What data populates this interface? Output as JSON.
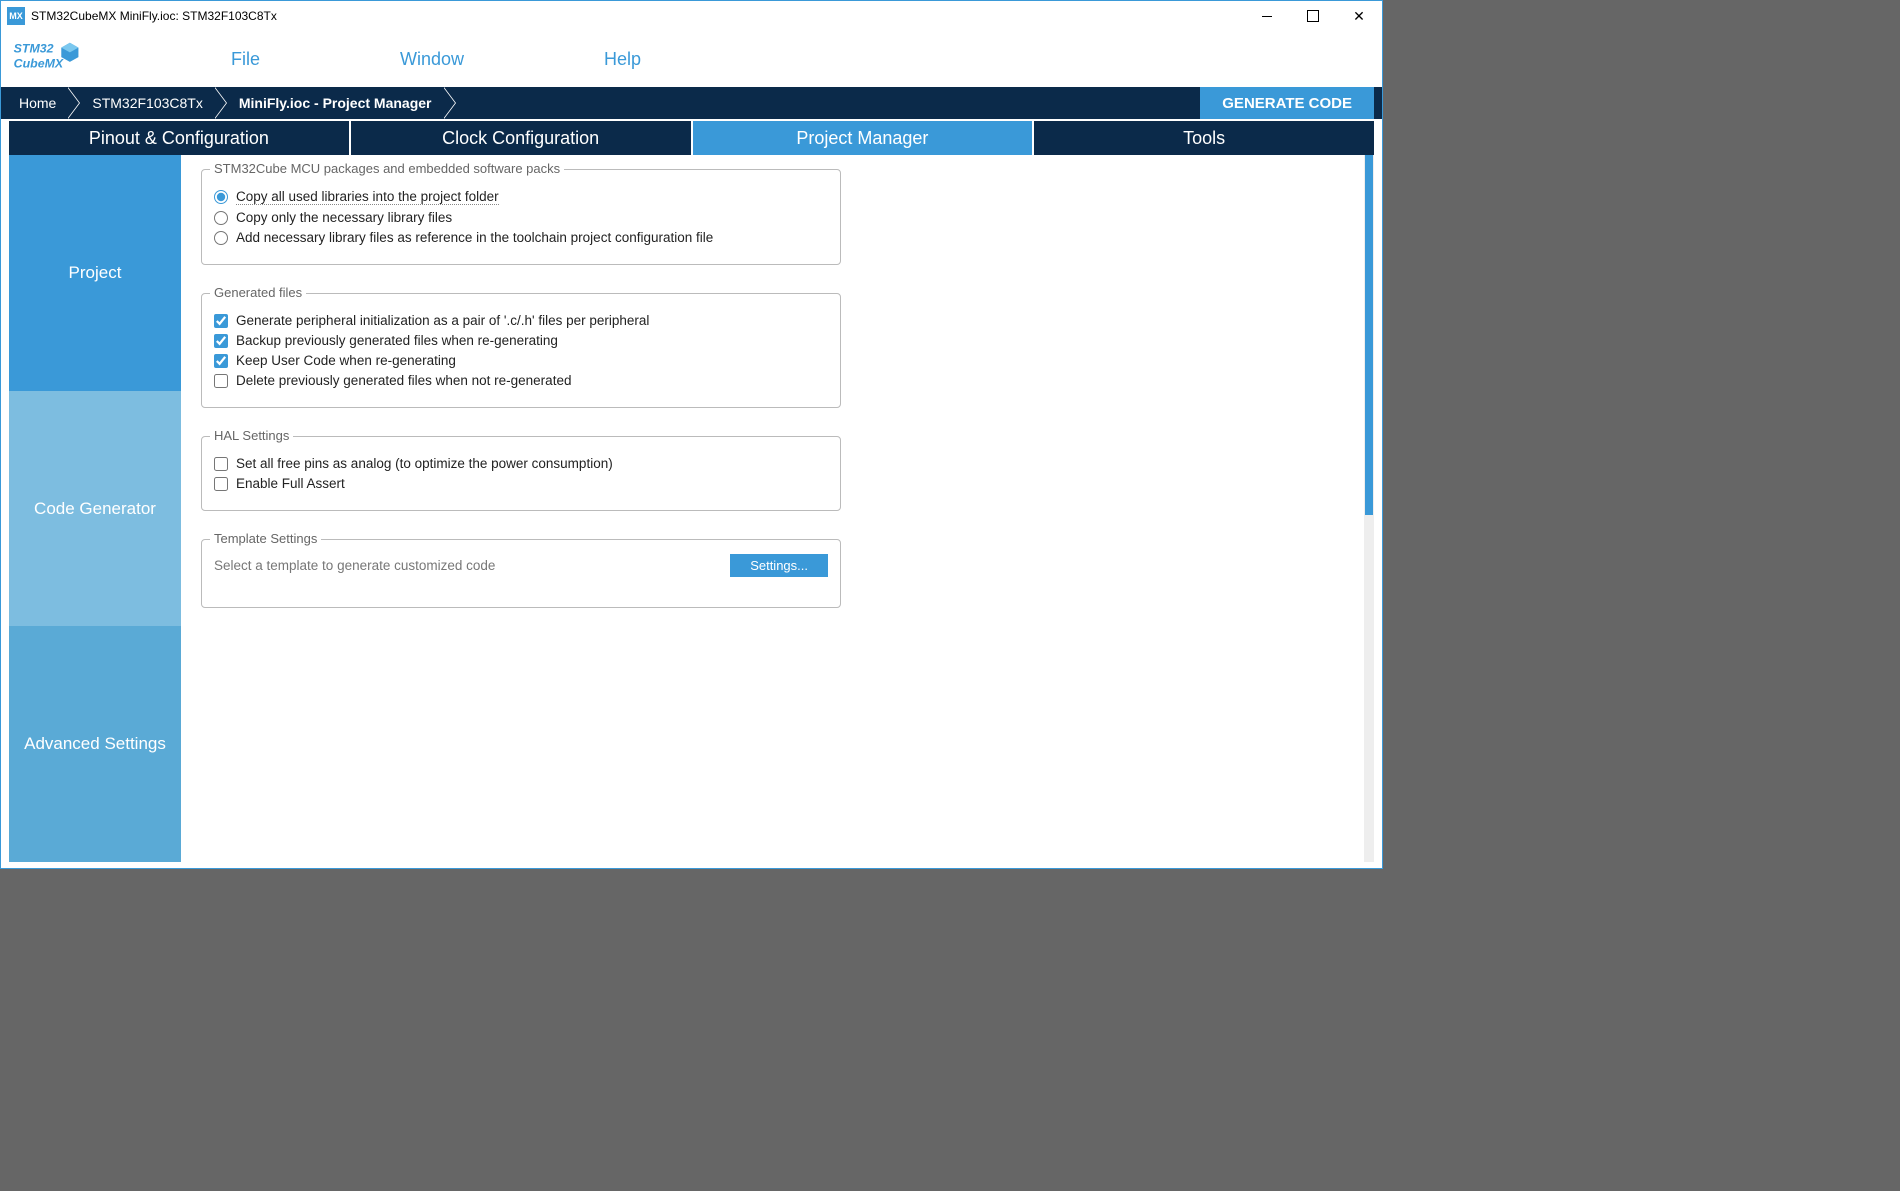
{
  "window": {
    "title": "STM32CubeMX MiniFly.ioc: STM32F103C8Tx",
    "app_badge": "MX"
  },
  "menubar": {
    "items": [
      "File",
      "Window",
      "Help"
    ],
    "logo_top": "STM32",
    "logo_bottom": "CubeMX"
  },
  "breadcrumbs": {
    "items": [
      "Home",
      "STM32F103C8Tx",
      "MiniFly.ioc - Project Manager"
    ],
    "generate": "GENERATE CODE"
  },
  "main_tabs": [
    "Pinout & Configuration",
    "Clock Configuration",
    "Project Manager",
    "Tools"
  ],
  "active_main_tab": 2,
  "sidebar": {
    "items": [
      "Project",
      "Code Generator",
      "Advanced Settings"
    ],
    "active": 1
  },
  "groups": {
    "packages": {
      "legend": "STM32Cube MCU packages and embedded software packs",
      "opts": [
        "Copy all used libraries into the project folder",
        "Copy only the necessary library files",
        "Add necessary library files as reference in the toolchain project configuration file"
      ],
      "selected": 0
    },
    "generated": {
      "legend": "Generated files",
      "opts": [
        "Generate peripheral initialization as a pair of '.c/.h' files per peripheral",
        "Backup previously generated files when re-generating",
        "Keep User Code when re-generating",
        "Delete previously generated files when not re-generated"
      ],
      "checked": [
        true,
        true,
        true,
        false
      ]
    },
    "hal": {
      "legend": "HAL Settings",
      "opts": [
        "Set all free pins as analog (to optimize the power consumption)",
        "Enable Full Assert"
      ],
      "checked": [
        false,
        false
      ]
    },
    "template": {
      "legend": "Template Settings",
      "text": "Select a template to generate customized code",
      "button": "Settings..."
    }
  },
  "colors": {
    "accent": "#3a99d8",
    "nav_dark": "#0b2a4a"
  }
}
